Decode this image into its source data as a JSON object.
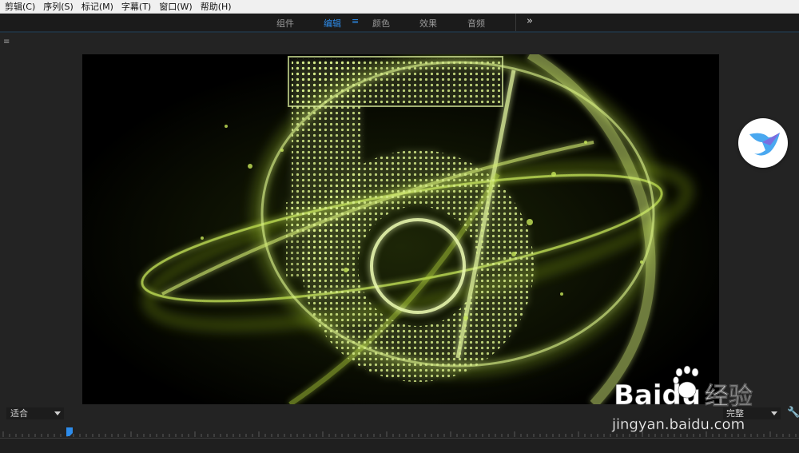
{
  "menu": [
    "剪辑(C)",
    "序列(S)",
    "标记(M)",
    "字幕(T)",
    "窗口(W)",
    "帮助(H)"
  ],
  "workspace": {
    "tabs": [
      "组件",
      "编辑",
      "颜色",
      "效果",
      "音频"
    ],
    "active": "编辑",
    "menu_glyph": "≡",
    "more_glyph": "»"
  },
  "panel": {
    "menu_glyph": "≡"
  },
  "controls": {
    "fit_label": "适合",
    "resolution_label": "完整",
    "wrench_glyph": "🔧"
  },
  "watermark": {
    "brand": "Baidu",
    "brand_cn": "经验",
    "url": "jingyan.baidu.com"
  },
  "colors": {
    "accent": "#2d8ceb",
    "background": "#232323",
    "glow": "#c8e85a"
  },
  "icons": [
    "panel-menu-icon",
    "chevron-down-icon",
    "wrench-icon",
    "playhead-icon",
    "bird-icon",
    "paw-icon"
  ]
}
